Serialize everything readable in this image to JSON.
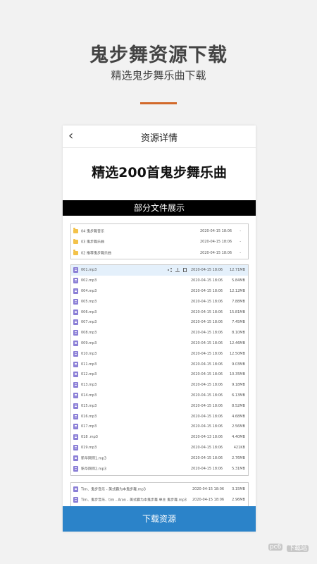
{
  "promo": {
    "title": "鬼步舞资源下载",
    "subtitle": "精选鬼步舞乐曲下载"
  },
  "nav": {
    "back": "‹",
    "title": "资源详情"
  },
  "headline": "精选200首鬼步舞乐曲",
  "section": "部分文件展示",
  "folders": [
    {
      "name": "04 鬼步舞音乐",
      "date": "2020-04-15 18:06",
      "size": "-"
    },
    {
      "name": "03 鬼步舞乐曲",
      "date": "2020-04-15 18:06",
      "size": "-"
    },
    {
      "name": "02 推荐鬼步舞乐曲",
      "date": "2020-04-15 18:06",
      "size": "-"
    }
  ],
  "files": [
    {
      "name": "001.mp3",
      "date": "2020-04-15 18:06",
      "size": "12.71MB"
    },
    {
      "name": "002.mp3",
      "date": "2020-04-15 18:06",
      "size": "5.84MB"
    },
    {
      "name": "004.mp3",
      "date": "2020-04-15 18:06",
      "size": "12.12MB"
    },
    {
      "name": "005.mp3",
      "date": "2020-04-15 18:06",
      "size": "7.88MB"
    },
    {
      "name": "006.mp3",
      "date": "2020-04-15 18:06",
      "size": "15.81MB"
    },
    {
      "name": "007.mp3",
      "date": "2020-04-15 18:06",
      "size": "7.45MB"
    },
    {
      "name": "008.mp3",
      "date": "2020-04-15 18:06",
      "size": "8.10MB"
    },
    {
      "name": "009.mp3",
      "date": "2020-04-15 18:06",
      "size": "12.46MB"
    },
    {
      "name": "010.mp3",
      "date": "2020-04-15 18:06",
      "size": "12.50MB"
    },
    {
      "name": "011.mp3",
      "date": "2020-04-15 18:06",
      "size": "9.03MB"
    },
    {
      "name": "012.mp3",
      "date": "2020-04-15 18:06",
      "size": "10.35MB"
    },
    {
      "name": "013.mp3",
      "date": "2020-04-15 18:06",
      "size": "9.18MB"
    },
    {
      "name": "014.mp3",
      "date": "2020-04-15 18:06",
      "size": "6.13MB"
    },
    {
      "name": "015.mp3",
      "date": "2020-04-15 18:06",
      "size": "8.52MB"
    },
    {
      "name": "016.mp3",
      "date": "2020-04-15 18:06",
      "size": "4.68MB"
    },
    {
      "name": "017.mp3",
      "date": "2020-04-15 18:06",
      "size": "2.56MB"
    },
    {
      "name": "018 .mp3",
      "date": "2020-04-13 18:06",
      "size": "4.40MB"
    },
    {
      "name": "019.mp3",
      "date": "2020-04-15 18:06",
      "size": "421KB"
    },
    {
      "name": "新华网师1.mp3",
      "date": "2020-04-15 18:06",
      "size": "2.76MB"
    },
    {
      "name": "新华网师2.mp3",
      "date": "2020-04-15 18:06",
      "size": "5.31MB"
    }
  ],
  "extra_files": [
    {
      "name": "Tim、鬼步音乐 - 美式霸为本鬼步舞.mp3",
      "date": "2020-04-15 18:06",
      "size": "3.15MB"
    },
    {
      "name": "Tim、鬼步音乐、tim - Aron - 美式霸为本鬼步舞 单主 鬼步舞.mp3",
      "date": "2020-04-15 18:06",
      "size": "2.96MB"
    }
  ],
  "download_button": "下载资源",
  "watermark": {
    "text": "pc6",
    "badge": "下载站"
  },
  "colors": {
    "accent": "#d2692a",
    "button": "#2b83c9",
    "highlight": "#e4f0fb",
    "folder": "#f3c24a",
    "file": "#8b7fd6"
  }
}
